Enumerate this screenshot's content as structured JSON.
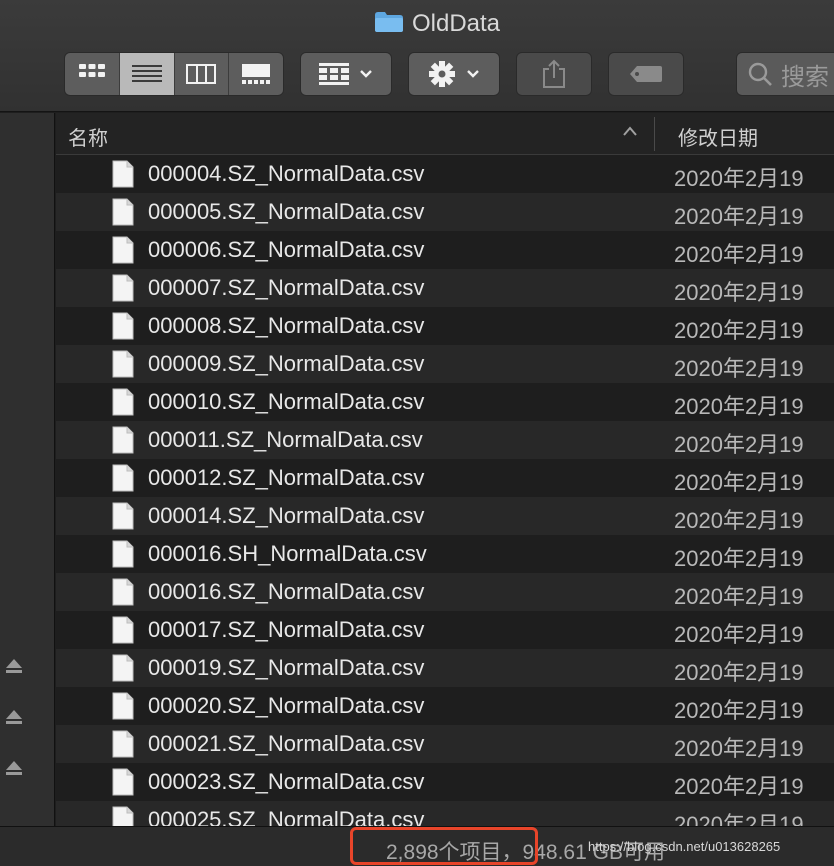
{
  "window": {
    "title": "OldData"
  },
  "toolbar": {
    "search_placeholder": "搜索"
  },
  "columns": {
    "name": "名称",
    "date": "修改日期"
  },
  "files": [
    {
      "name": "000004.SZ_NormalData.csv",
      "date": "2020年2月19"
    },
    {
      "name": "000005.SZ_NormalData.csv",
      "date": "2020年2月19"
    },
    {
      "name": "000006.SZ_NormalData.csv",
      "date": "2020年2月19"
    },
    {
      "name": "000007.SZ_NormalData.csv",
      "date": "2020年2月19"
    },
    {
      "name": "000008.SZ_NormalData.csv",
      "date": "2020年2月19"
    },
    {
      "name": "000009.SZ_NormalData.csv",
      "date": "2020年2月19"
    },
    {
      "name": "000010.SZ_NormalData.csv",
      "date": "2020年2月19"
    },
    {
      "name": "000011.SZ_NormalData.csv",
      "date": "2020年2月19"
    },
    {
      "name": "000012.SZ_NormalData.csv",
      "date": "2020年2月19"
    },
    {
      "name": "000014.SZ_NormalData.csv",
      "date": "2020年2月19"
    },
    {
      "name": "000016.SH_NormalData.csv",
      "date": "2020年2月19"
    },
    {
      "name": "000016.SZ_NormalData.csv",
      "date": "2020年2月19"
    },
    {
      "name": "000017.SZ_NormalData.csv",
      "date": "2020年2月19"
    },
    {
      "name": "000019.SZ_NormalData.csv",
      "date": "2020年2月19"
    },
    {
      "name": "000020.SZ_NormalData.csv",
      "date": "2020年2月19"
    },
    {
      "name": "000021.SZ_NormalData.csv",
      "date": "2020年2月19"
    },
    {
      "name": "000023.SZ_NormalData.csv",
      "date": "2020年2月19"
    },
    {
      "name": "000025.SZ_NormalData.csv",
      "date": "2020年2月19"
    }
  ],
  "status": {
    "text": "2,898个项目，948.61 GB可用",
    "watermark": "https://blog.csdn.net/u013628265"
  },
  "colors": {
    "highlight": "#e8452a",
    "folder": "#5ea7e0"
  }
}
